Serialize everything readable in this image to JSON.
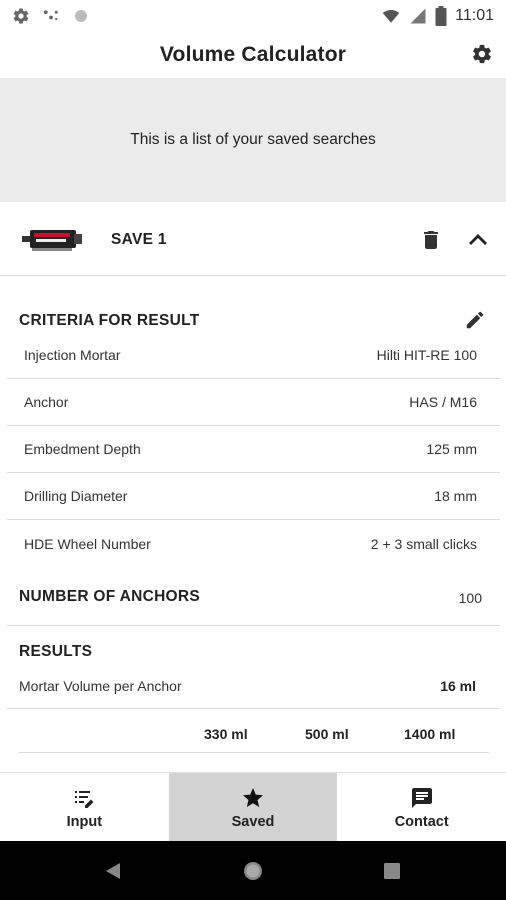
{
  "status_bar": {
    "time": "11:01",
    "icons": [
      "settings-icon",
      "dots-icon",
      "circle-icon",
      "wifi-icon",
      "signal-icon",
      "battery-icon"
    ]
  },
  "app_bar": {
    "title": "Volume Calculator",
    "settings_icon": "gear-icon"
  },
  "banner": {
    "text": "This is a list of your saved searches"
  },
  "save": {
    "label": "SAVE 1",
    "delete_icon": "trash-icon",
    "collapse_icon": "chevron-up-icon"
  },
  "criteria": {
    "title": "CRITERIA FOR RESULT",
    "edit_icon": "pencil-icon",
    "rows": [
      {
        "label": "Injection Mortar",
        "value": "Hilti HIT-RE 100"
      },
      {
        "label": "Anchor",
        "value": "HAS / M16"
      },
      {
        "label": "Embedment Depth",
        "value": "125 mm"
      },
      {
        "label": "Drilling Diameter",
        "value": "18 mm"
      },
      {
        "label": "HDE Wheel Number",
        "value": "2 + 3 small clicks"
      }
    ]
  },
  "anchors": {
    "title": "NUMBER OF ANCHORS",
    "value": "100"
  },
  "results": {
    "title": "RESULTS",
    "mortar_label": "Mortar Volume per Anchor",
    "mortar_value": "16 ml",
    "packs": [
      "330 ml",
      "500 ml",
      "1400 ml"
    ]
  },
  "bottom_nav": {
    "tabs": [
      {
        "label": "Input",
        "icon": "checklist-edit-icon",
        "active": false
      },
      {
        "label": "Saved",
        "icon": "star-icon",
        "active": true
      },
      {
        "label": "Contact",
        "icon": "message-icon",
        "active": false
      }
    ]
  },
  "system_nav": {
    "buttons": [
      "back-icon",
      "home-icon",
      "recents-icon"
    ]
  },
  "colors": {
    "banner_bg": "#ebebeb",
    "active_tab_bg": "#d3d3d3",
    "product_red": "#c8102e"
  }
}
